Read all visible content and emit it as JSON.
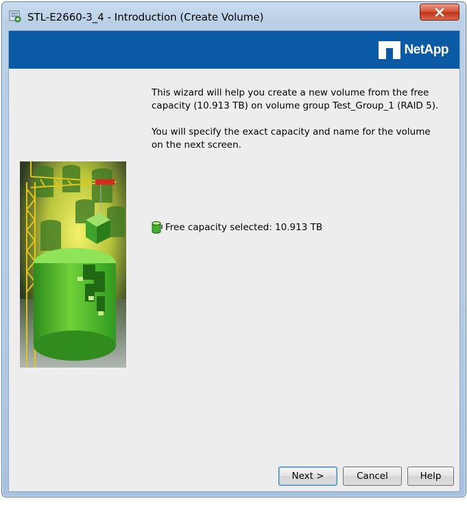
{
  "window": {
    "title": "STL-E2660-3_4 - Introduction (Create Volume)",
    "close_icon": "close-icon"
  },
  "banner": {
    "logo_text": "NetApp",
    "background": "#0b5aa5"
  },
  "intro": {
    "paragraph1": "This wizard will help you create a new volume from the free capacity (10.913 TB) on volume group Test_Group_1 (RAID 5).",
    "paragraph2": "You will specify the exact capacity and name for the volume on the next screen."
  },
  "capacity": {
    "label": "Free capacity selected: 10.913 TB",
    "icon": "database-icon"
  },
  "buttons": {
    "next": "Next >",
    "cancel": "Cancel",
    "help": "Help"
  }
}
